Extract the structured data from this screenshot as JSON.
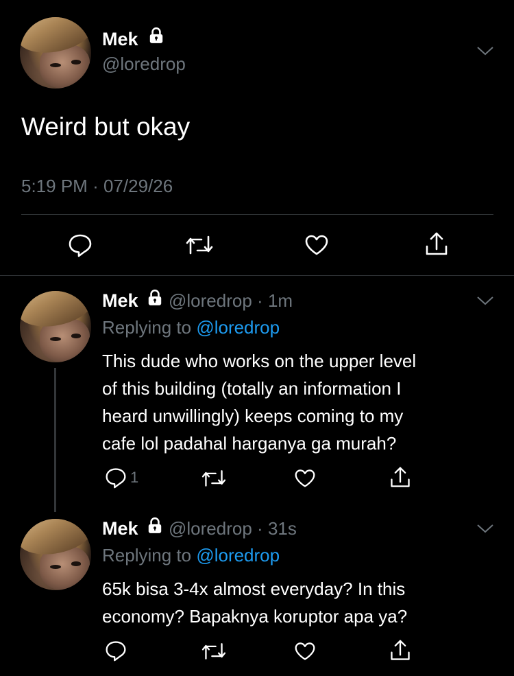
{
  "main_tweet": {
    "name": "Mek",
    "handle": "@loredrop",
    "text": "Weird but okay",
    "time": "5:19 PM",
    "sep": "·",
    "date": "07/29/26"
  },
  "replies": [
    {
      "name": "Mek",
      "handle": "@loredrop",
      "time": "1m",
      "replying_prefix": "Replying to",
      "replying_to": "@loredrop",
      "lines": [
        "This dude who works on the upper level",
        "of this building (totally an information I",
        "heard unwillingly) keeps coming to my",
        "cafe lol padahal harganya ga murah?"
      ],
      "reply_count": "1"
    },
    {
      "name": "Mek",
      "handle": "@loredrop",
      "time": "31s",
      "replying_prefix": "Replying to",
      "replying_to": "@loredrop",
      "lines": [
        "65k bisa 3-4x almost everyday? In this",
        "economy? Bapaknya koruptor apa ya?"
      ],
      "reply_count": ""
    }
  ],
  "icons": [
    "lock-icon",
    "chevron-down-icon",
    "reply-icon",
    "retweet-icon",
    "like-icon",
    "share-icon"
  ],
  "colors": {
    "background": "#000000",
    "text": "#ffffff",
    "muted": "#6e767d",
    "accent": "#1d9bf0",
    "divider": "#2f3336"
  }
}
